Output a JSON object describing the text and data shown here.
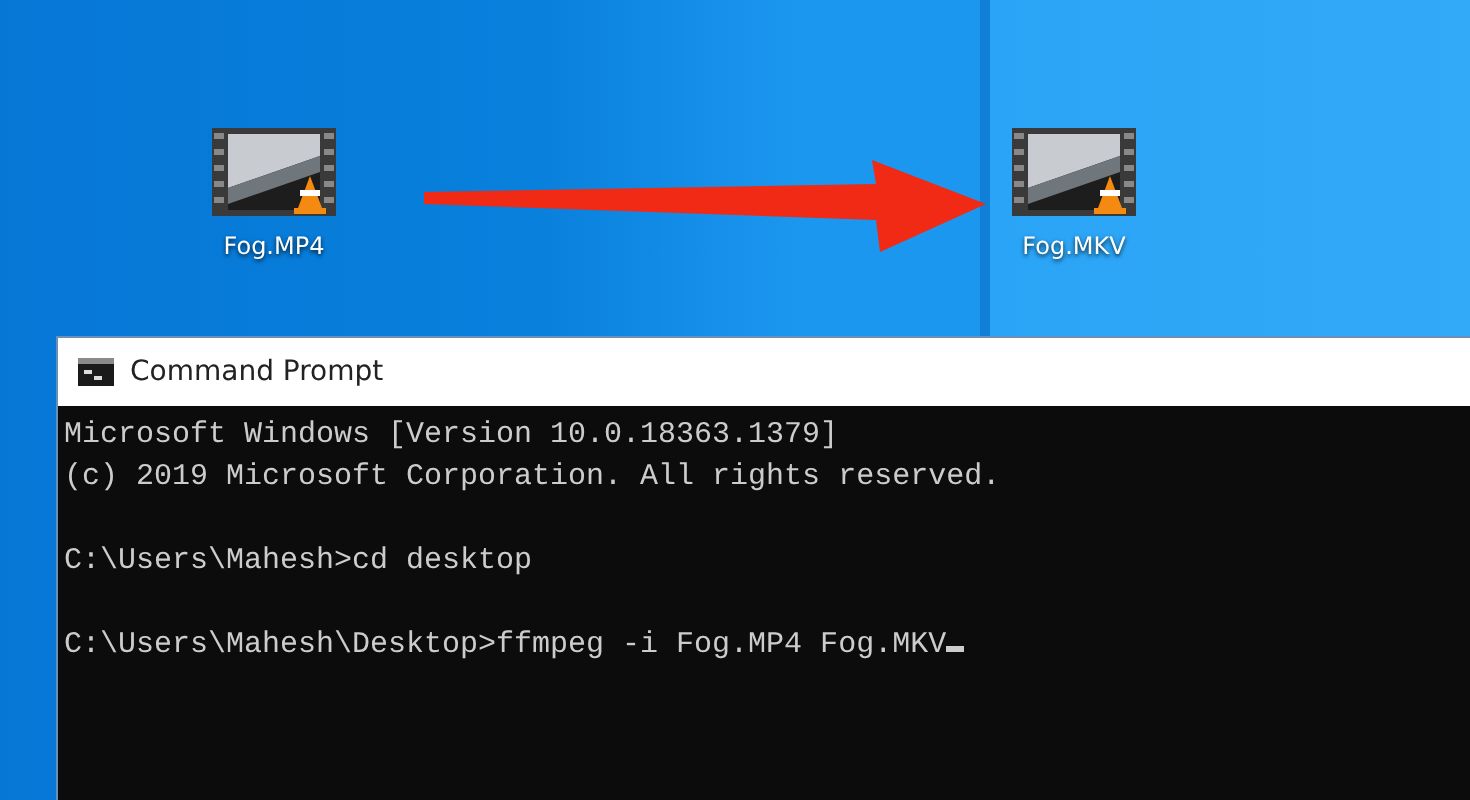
{
  "desktop_icons": [
    {
      "label": "Fog.MP4"
    },
    {
      "label": "Fog.MKV"
    }
  ],
  "window": {
    "title": "Command Prompt"
  },
  "console": [
    {
      "kind": "output",
      "text": "Microsoft Windows [Version 10.0.18363.1379]"
    },
    {
      "kind": "output",
      "text": "(c) 2019 Microsoft Corporation. All rights reserved."
    },
    {
      "kind": "prompt",
      "text": "C:\\Users\\Mahesh>cd desktop"
    },
    {
      "kind": "prompt",
      "text": "C:\\Users\\Mahesh\\Desktop>ffmpeg -i Fog.MP4 Fog.MKV",
      "cursor": true
    }
  ]
}
